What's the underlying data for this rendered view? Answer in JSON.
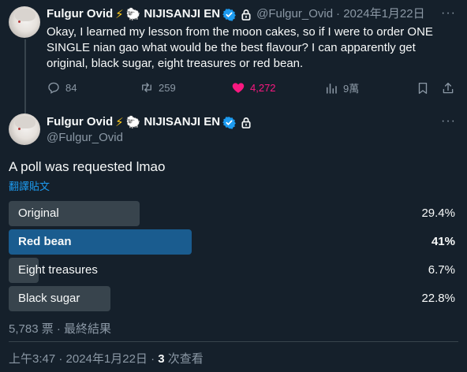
{
  "parent_tweet": {
    "display_name": "Fulgur Ovid",
    "name_suffix": "NIJISANJI EN",
    "handle": "@Fulgur_Ovid",
    "date": "· 2024年1月22日",
    "more": "···",
    "text": "Okay, I learned my lesson from the moon cakes, so if I were to order ONE SINGLE nian gao what would be the best flavour? I can apparently get original, black sugar, eight treasures or red bean.",
    "actions": {
      "replies": "84",
      "retweets": "259",
      "likes": "4,272",
      "views": "9萬"
    }
  },
  "main_tweet": {
    "display_name": "Fulgur Ovid",
    "name_suffix": "NIJISANJI EN",
    "handle": "@Fulgur_Ovid",
    "more": "···",
    "text": "A poll was requested lmao",
    "translate": "翻譯貼文",
    "poll": {
      "options": [
        {
          "label": "Original",
          "percent": "29.4%",
          "value": 29.4,
          "winner": false
        },
        {
          "label": "Red bean",
          "percent": "41%",
          "value": 41,
          "winner": true
        },
        {
          "label": "Eight treasures",
          "percent": "6.7%",
          "value": 6.7,
          "winner": false
        },
        {
          "label": "Black sugar",
          "percent": "22.8%",
          "value": 22.8,
          "winner": false
        }
      ],
      "meta": "5,783 票 · 最終結果"
    },
    "timestamp_prefix": "上午3:47 · 2024年1月22日 · ",
    "views_count": "3",
    "views_suffix": " 次查看"
  },
  "colors": {
    "background": "#15202b",
    "accent": "#1d9bf0",
    "like": "#f91880",
    "poll_bar": "#38444d",
    "poll_winner": "#1a5c8f",
    "verified": "#1d9bf0"
  },
  "icons": {
    "emoji_1": "⚡",
    "emoji_2": "🐑"
  }
}
